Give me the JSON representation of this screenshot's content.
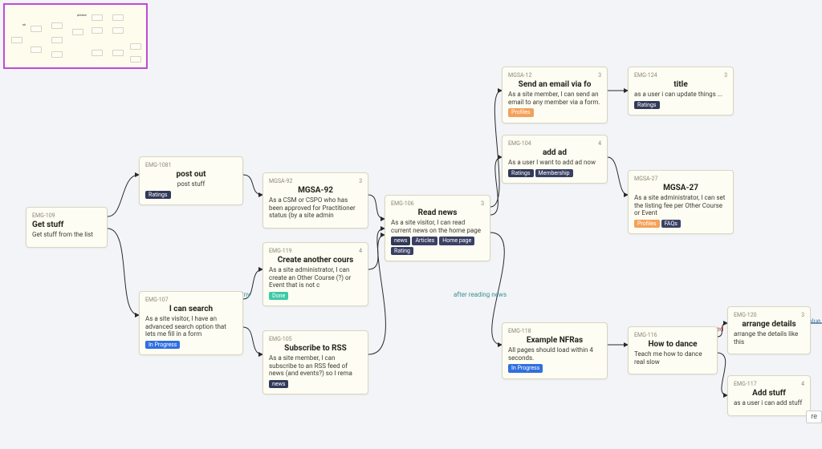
{
  "nodes": {
    "n1": {
      "id": "EMG-109",
      "count": "",
      "title": "Get stuff",
      "desc": "Get stuff from the list",
      "tags": []
    },
    "n2": {
      "id": "EMG-1081",
      "count": "",
      "title": "post out",
      "desc": "post stuff",
      "tags": [
        {
          "label": "Ratings",
          "cls": "t-ratings"
        }
      ]
    },
    "n3": {
      "id": "EMG-107",
      "count": "",
      "title": "I can search",
      "desc": "As a site visitor, I have an advanced search option that lets me fill in a form",
      "tags": [
        {
          "label": "In Progress",
          "cls": "t-progress"
        }
      ]
    },
    "n4": {
      "id": "MGSA-92",
      "count": "3",
      "title": "MGSA-92",
      "desc": "As a CSM or CSPO who has been approved for Practitioner status (by a site admin",
      "tags": []
    },
    "n5": {
      "id": "EMG-119",
      "count": "4",
      "title": "Create another cours",
      "desc": "As a site administrator, I can create an Other Course (?) or Event that is not c",
      "tags": [
        {
          "label": "Done",
          "cls": "t-done"
        }
      ]
    },
    "n6": {
      "id": "EMG-105",
      "count": "",
      "title": "Subscribe to RSS",
      "desc": "As a site member, I can subscribe to an RSS feed of news (and events?) so I rema",
      "tags": [
        {
          "label": "news",
          "cls": "t-news"
        }
      ]
    },
    "n7": {
      "id": "EMG-106",
      "count": "3",
      "title": "Read news",
      "desc": "As a site visitor, I can read current news on the home page",
      "tags": [
        {
          "label": "news",
          "cls": "t-news"
        },
        {
          "label": "Articles",
          "cls": "t-articles"
        },
        {
          "label": "Home page",
          "cls": "t-homepage"
        },
        {
          "label": "Rating",
          "cls": "t-rating"
        }
      ]
    },
    "n8": {
      "id": "MGSA-12",
      "count": "3",
      "title": "Send an email via fo",
      "desc": "As a site member, I can send an email to any member via a form.",
      "tags": [
        {
          "label": "Profiles",
          "cls": "t-profiles"
        }
      ]
    },
    "n9": {
      "id": "EMG-104",
      "count": "4",
      "title": "add ad",
      "desc": "As a user I want to add ad now",
      "tags": [
        {
          "label": "Ratings",
          "cls": "t-ratings"
        },
        {
          "label": "Membership",
          "cls": "t-membership"
        }
      ]
    },
    "n10": {
      "id": "EMG-124",
      "count": "3",
      "title": "title",
      "desc": "as a user i can update things ...",
      "tags": [
        {
          "label": "Ratings",
          "cls": "t-ratings"
        }
      ]
    },
    "n11": {
      "id": "MGSA-27",
      "count": "",
      "title": "MGSA-27",
      "desc": "As a site administrator, I can set the listing fee per Other Course or Event",
      "tags": [
        {
          "label": "Profiles",
          "cls": "t-profiles"
        },
        {
          "label": "FAQs",
          "cls": "t-faqs"
        }
      ]
    },
    "n12": {
      "id": "EMG-118",
      "count": "",
      "title": "Example NFRas",
      "desc": "All pages should load within 4 seconds.",
      "tags": [
        {
          "label": "In Progress",
          "cls": "t-progress"
        }
      ]
    },
    "n13": {
      "id": "EMG-116",
      "count": "",
      "title": "How to dance",
      "desc": "Teach me how to dance real slow",
      "tags": []
    },
    "n14": {
      "id": "EMG-120",
      "count": "3",
      "title": "arrange details",
      "desc": "arrange the details like this",
      "tags": []
    },
    "n15": {
      "id": "EMG-117",
      "count": "4",
      "title": "Add stuff",
      "desc": "as a user i can add stuff",
      "tags": []
    }
  },
  "edge_labels": {
    "l1": "tiny",
    "l2": "after reading news",
    "l3": "red",
    "l4": "blue"
  },
  "floater": {
    "text": "re"
  },
  "minimap_labels": [
    "ok",
    "please"
  ]
}
